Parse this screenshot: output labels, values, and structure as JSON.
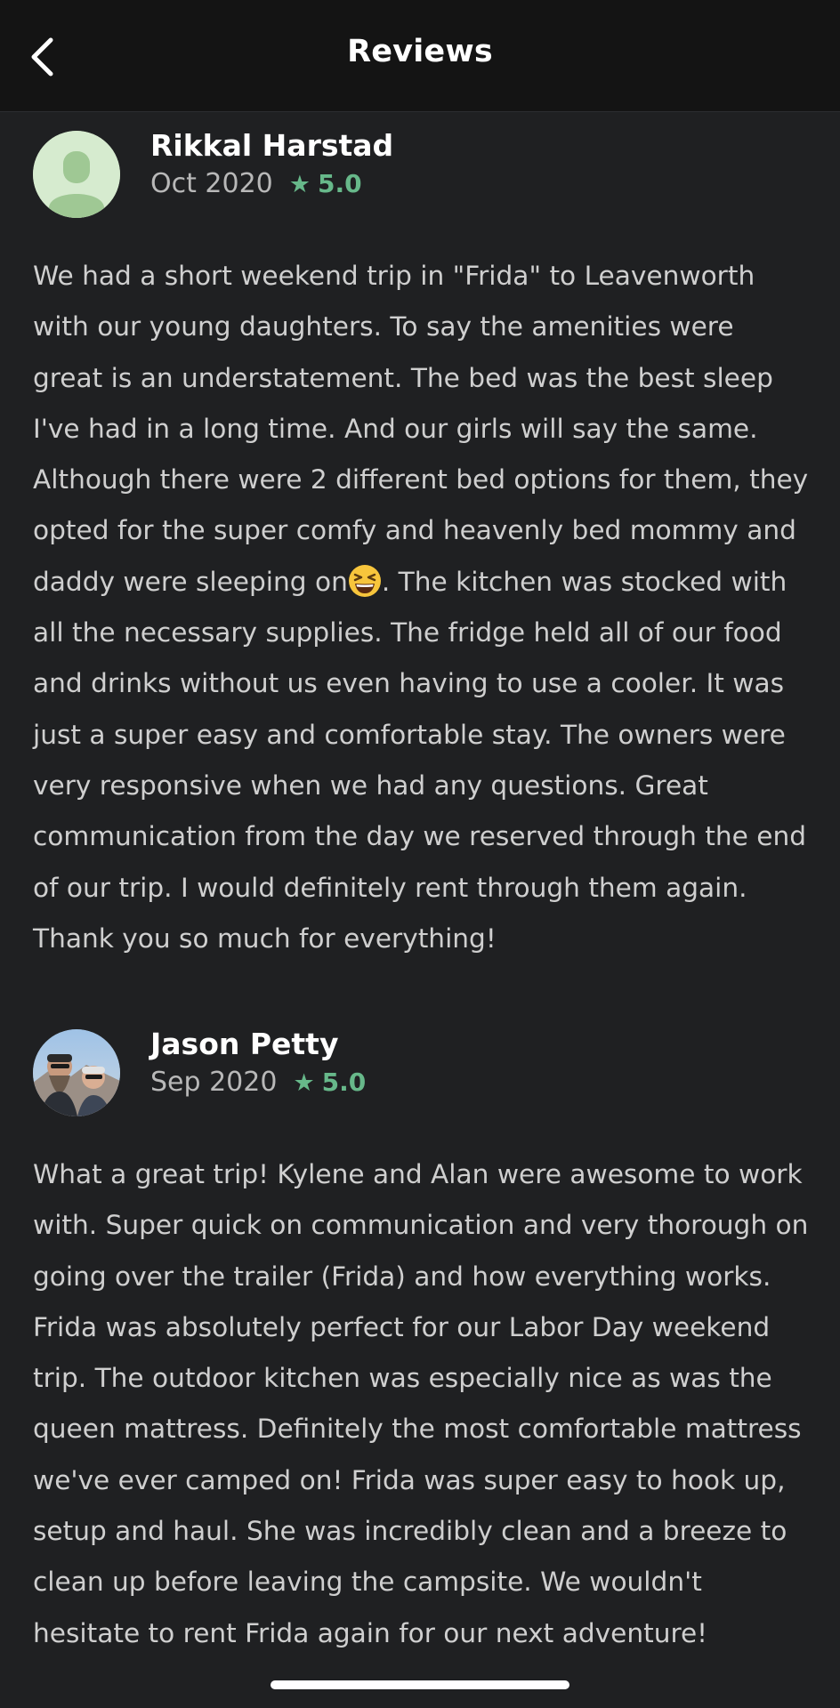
{
  "header": {
    "title": "Reviews",
    "back_icon": "chevron-left-icon"
  },
  "reviews": [
    {
      "name": "Rikkal Harstad",
      "date": "Oct 2020",
      "rating": "5.0",
      "avatar": "default-avatar-icon",
      "body_part1": "We had a short weekend trip in \"Frida\" to Leavenworth with our young daughters.  To say the amenities were great is an understatement.  The bed was the best sleep I've had in a long time.  And our girls will say the same. Although there were 2 different bed options for them, they opted for the super comfy and heavenly bed mommy and daddy were sleeping on",
      "emoji": "grinning-squinting-face-emoji",
      "body_part2": ". The kitchen was stocked with all the necessary supplies. The fridge held all of our food and drinks without us even having to use a cooler.  It was just a super easy and comfortable stay.  The owners were very responsive when we had any questions.  Great communication from the day we reserved through the end of our trip.  I would definitely rent through them again. Thank you so much for everything!"
    },
    {
      "name": "Jason Petty",
      "date": "Sep 2020",
      "rating": "5.0",
      "avatar": "user-photo-avatar",
      "body": "What a great trip! Kylene and Alan were awesome to work with. Super quick on communication and very thorough on going over the trailer (Frida) and how everything works. Frida was absolutely perfect for our Labor Day weekend trip. The outdoor kitchen was especially nice as was the queen mattress. Definitely the most comfortable mattress we've ever camped on! Frida was super easy to hook up, setup and haul. She was incredibly clean and a breeze to clean up before leaving the campsite. We wouldn't hesitate to rent Frida again for our next adventure!"
    }
  ],
  "colors": {
    "background": "#1f2022",
    "header_background": "#141414",
    "rating_green": "#67b88a",
    "text": "#cfcfcf"
  }
}
